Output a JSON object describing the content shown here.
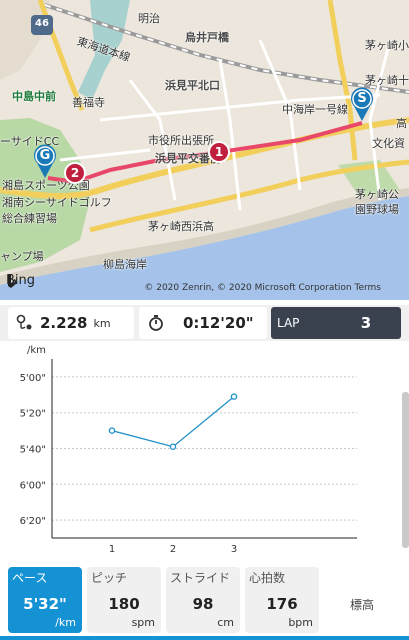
{
  "map": {
    "labels": {
      "meiji": "明治",
      "route46": "46",
      "tokaido": "東海道本線",
      "torii": "烏井戸橋",
      "chigasaki_sho": "茅ヶ崎小",
      "chigasaki_ju": "茅ヶ崎十",
      "nakajima_mae": "中島中前",
      "zenpuku": "善福寺",
      "hamami_kita": "浜見平北口",
      "nakakaigan": "中海岸一号線",
      "seaside_cc": "ーサイドCC",
      "shiyakusho": "市役所出張所",
      "hamami_kosaten": "浜見平交番前",
      "bunka": "文化資",
      "taka": "高",
      "sports_park": "湘島スポーツ公園",
      "seaside_golf": "湘南シーサイドゴルフ",
      "sogo": "総合練習場",
      "chigasaki_nishi": "茅ヶ崎西浜高",
      "chigasaki_ko": "茅ヶ崎公",
      "yakyujo": "園野球場",
      "camp": "ャンプ場",
      "yanagishima": "柳島海岸"
    },
    "markers": {
      "start": "S",
      "goal": "G",
      "lap1": "1",
      "lap2": "2"
    },
    "route_color": "#e8476a",
    "logo_text": "Bing",
    "copyright": "© 2020 Zenrin, © 2020 Microsoft Corporation  Terms"
  },
  "stats": {
    "distance": {
      "value": "2.228",
      "unit": "km",
      "icon": "route-icon"
    },
    "time": {
      "value": "0:12'20\"",
      "icon": "stopwatch-icon"
    },
    "lap": {
      "label": "LAP",
      "value": "3"
    }
  },
  "chart_data": {
    "type": "line",
    "ylabel": "/km",
    "x": [
      1,
      2,
      3
    ],
    "x_ticks": [
      "1",
      "2",
      "3"
    ],
    "y_ticks": [
      "5'00\"",
      "5'20\"",
      "5'40\"",
      "6'00\"",
      "6'20\""
    ],
    "y_tick_seconds": [
      300,
      320,
      340,
      360,
      380
    ],
    "ylim_seconds": [
      290,
      390
    ],
    "y_inverted": true,
    "series": [
      {
        "values_seconds": [
          330,
          339,
          311
        ],
        "color": "#1e8fc7"
      }
    ],
    "grid": true
  },
  "metrics": [
    {
      "label": "ペース",
      "value": "5'32\"",
      "unit": "/km",
      "active": true
    },
    {
      "label": "ピッチ",
      "value": "180",
      "unit": "spm",
      "active": false
    },
    {
      "label": "ストライド",
      "value": "98",
      "unit": "cm",
      "active": false
    },
    {
      "label": "心拍数",
      "value": "176",
      "unit": "bpm",
      "active": false
    }
  ],
  "metric_alt": {
    "label": "標高"
  },
  "colors": {
    "accent": "#1592d3",
    "lap_bg": "#3a4250"
  }
}
